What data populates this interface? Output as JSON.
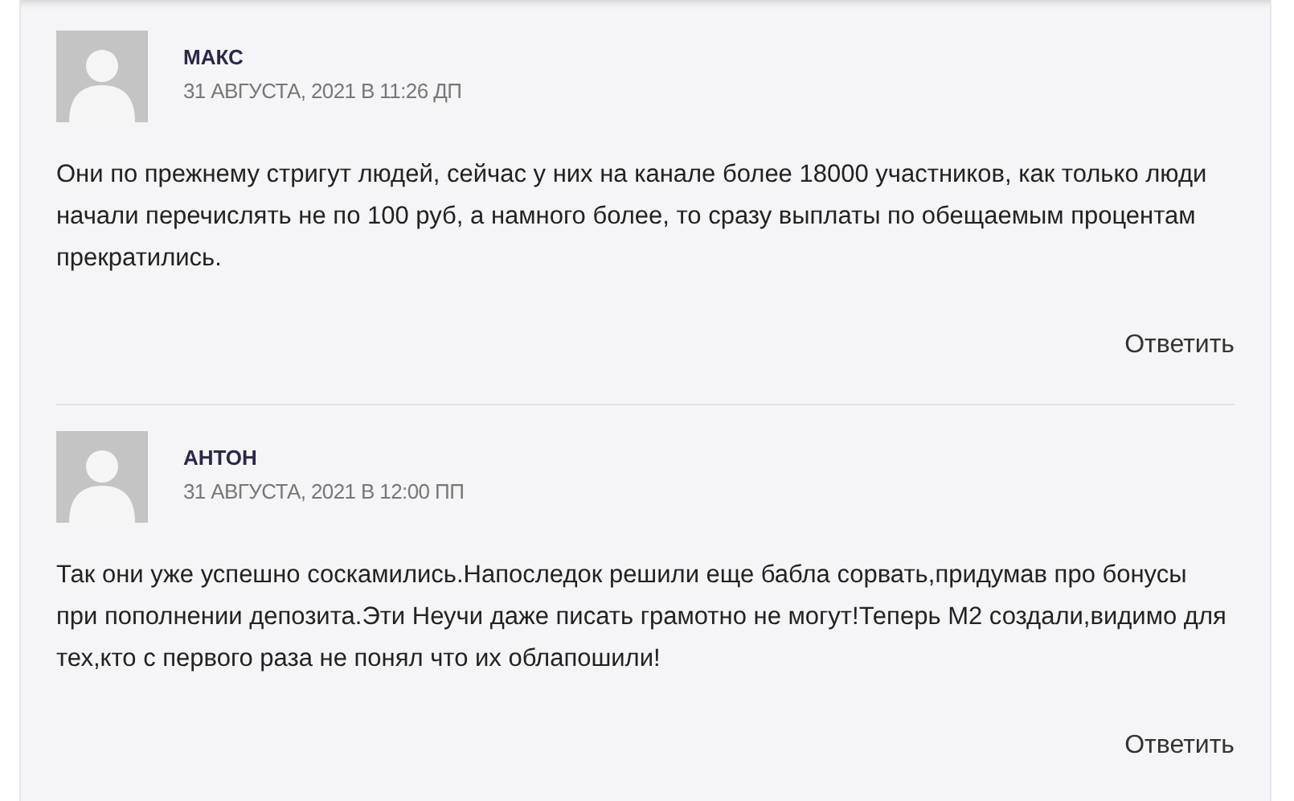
{
  "comments": [
    {
      "author": "МАКС",
      "date": "31 АВГУСТА, 2021 В 11:26 ДП",
      "text": "Они по прежнему стригут людей, сейчас у них на канале более 18000 участников, как только люди начали перечислять не по 100 руб, а намного более, то сразу выплаты по обещаемым процентам прекратились.",
      "reply": "Ответить"
    },
    {
      "author": "АНТОН",
      "date": "31 АВГУСТА, 2021 В 12:00 ПП",
      "text": "Так они уже успешно соскамились.Напоследок решили еще бабла сорвать,придумав про бонусы при пополнении депозита.Эти Неучи даже писать грамотно не могут!Теперь М2 создали,видимо для тех,кто с первого раза не понял что их облапошили!",
      "reply": "Ответить"
    }
  ]
}
